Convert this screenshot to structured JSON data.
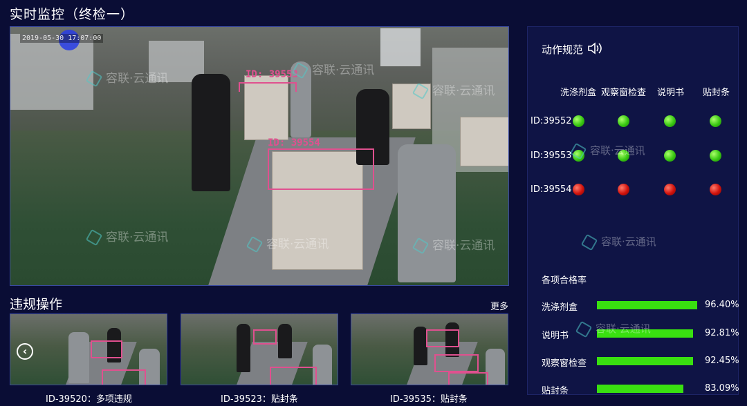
{
  "page_title": "实时监控（终检一）",
  "video": {
    "timestamp": "2019-05-30 17:07:00",
    "detections": [
      {
        "label": "ID: 39553"
      },
      {
        "label": "ID: 39554"
      }
    ],
    "watermark": "容联·云通讯"
  },
  "compliance": {
    "title": "动作规范",
    "speaker_icon": "speaker-icon",
    "columns": [
      "洗涤剂盒",
      "观察窗检查",
      "说明书",
      "贴封条"
    ],
    "rows": [
      {
        "id": "ID:39552",
        "status": [
          "green",
          "green",
          "green",
          "green"
        ]
      },
      {
        "id": "ID:39553",
        "status": [
          "green",
          "green",
          "green",
          "green"
        ]
      },
      {
        "id": "ID:39554",
        "status": [
          "red",
          "red",
          "red",
          "red"
        ]
      }
    ],
    "colors": {
      "ok": "#38c812",
      "fail": "#d0120c"
    }
  },
  "pass_rates": {
    "title": "各项合格率",
    "items": [
      {
        "label": "洗涤剂盒",
        "value": "96.40%",
        "fraction": 0.964
      },
      {
        "label": "说明书",
        "value": "92.81%",
        "fraction": 0.9281
      },
      {
        "label": "观察窗检查",
        "value": "92.45%",
        "fraction": 0.9245
      },
      {
        "label": "贴封条",
        "value": "83.09%",
        "fraction": 0.8309
      }
    ],
    "bar_color": "#39e010"
  },
  "violations": {
    "title": "违规操作",
    "more_label": "更多",
    "prev_icon": "chevron-left-icon",
    "items": [
      {
        "caption": "ID-39520：多项违规"
      },
      {
        "caption": "ID-39523：贴封条"
      },
      {
        "caption": "ID-39535：贴封条"
      }
    ]
  }
}
